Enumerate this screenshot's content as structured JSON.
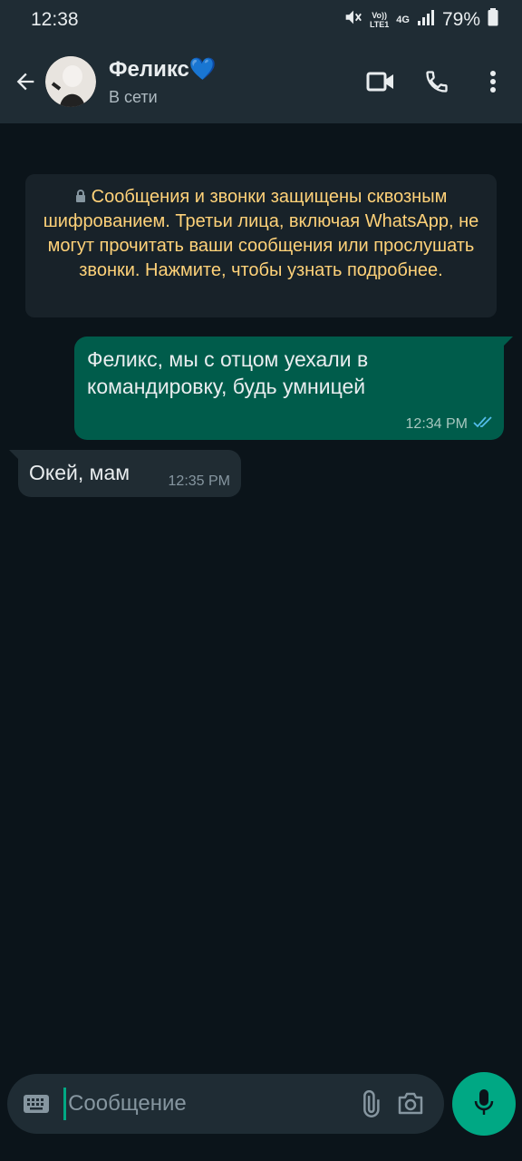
{
  "status_bar": {
    "time": "12:38",
    "network_top": "Vo))",
    "network_bottom": "LTE1",
    "network_type": "4G",
    "battery": "79%",
    "icons": [
      "mute-icon",
      "signal-icon",
      "battery-icon"
    ]
  },
  "header": {
    "name": "Феликс💙",
    "status": "В сети",
    "icons": [
      "back-arrow-icon",
      "video-call-icon",
      "voice-call-icon",
      "more-vert-icon"
    ]
  },
  "chat": {
    "encryption_notice": "Сообщения и звонки защищены сквозным шифрованием. Третьи лица, включая WhatsApp, не могут прочитать ваши сообщения или прослушать звонки. Нажмите, чтобы узнать подробнее.",
    "messages": [
      {
        "direction": "outgoing",
        "text": "Феликс, мы с отцом уехали в командировку, будь умницей",
        "time": "12:34 PM",
        "status": "read"
      },
      {
        "direction": "incoming",
        "text": "Окей, мам",
        "time": "12:35 PM"
      }
    ]
  },
  "input": {
    "placeholder": "Сообщение",
    "value": "",
    "icons": [
      "keyboard-icon",
      "attach-icon",
      "camera-icon",
      "mic-icon"
    ]
  },
  "colors": {
    "background": "#0b141a",
    "header": "#1f2c34",
    "outgoing_bubble": "#005c4b",
    "incoming_bubble": "#202c33",
    "notice_text": "#ffd279",
    "accent": "#00a884",
    "read_ticks": "#53bdeb"
  }
}
